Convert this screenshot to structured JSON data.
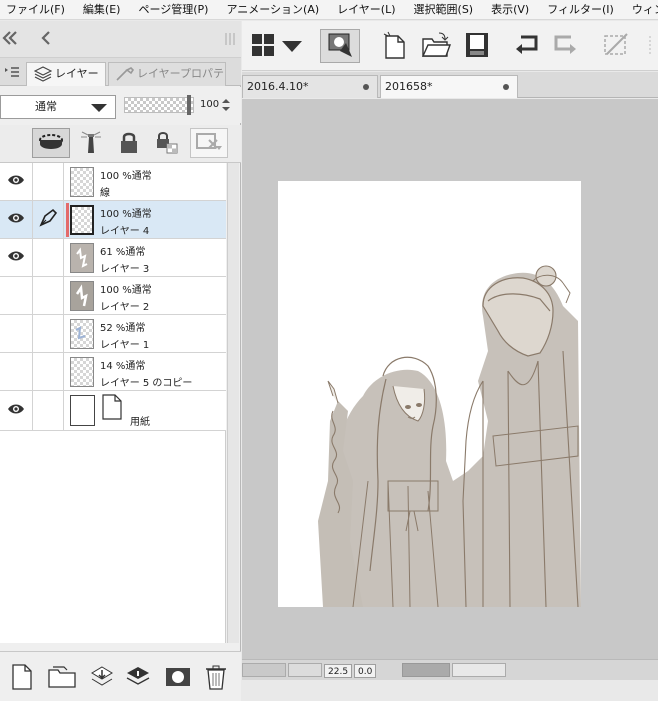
{
  "menu": [
    "ファイル(F)",
    "編集(E)",
    "ページ管理(P)",
    "アニメーション(A)",
    "レイヤー(L)",
    "選択範囲(S)",
    "表示(V)",
    "フィルター(I)",
    "ウィンドウ(W)"
  ],
  "panel": {
    "tabs": [
      {
        "label": "レイヤー",
        "icon": "layers-icon"
      },
      {
        "label": "レイヤープロパティ",
        "icon": "wrench-icon"
      }
    ],
    "blend_mode": "通常",
    "opacity": "100"
  },
  "layers": [
    {
      "mode": "100 %通常",
      "name": "線",
      "visible": true,
      "editing": false,
      "selected": false
    },
    {
      "mode": "100 %通常",
      "name": "レイヤー 4",
      "visible": true,
      "editing": true,
      "selected": true
    },
    {
      "mode": "61 %通常",
      "name": "レイヤー 3",
      "visible": true,
      "editing": false,
      "selected": false
    },
    {
      "mode": "100 %通常",
      "name": "レイヤー 2",
      "visible": false,
      "editing": false,
      "selected": false
    },
    {
      "mode": "52 %通常",
      "name": "レイヤー 1",
      "visible": false,
      "editing": false,
      "selected": false
    },
    {
      "mode": "14 %通常",
      "name": "レイヤー 5 のコピー",
      "visible": false,
      "editing": false,
      "selected": false
    }
  ],
  "paper_layer": {
    "name": "用紙",
    "visible": true
  },
  "doc_tabs": [
    "2016.4.10*",
    "201658*"
  ],
  "status": {
    "zoom": "22.5",
    "angle": "0.0"
  },
  "colors": {
    "accent_selected": "#d9e8f5",
    "edit_marker": "#e36a6a",
    "line_art": "#8a7a6a",
    "canvas_bg": "#c8c8c8"
  }
}
